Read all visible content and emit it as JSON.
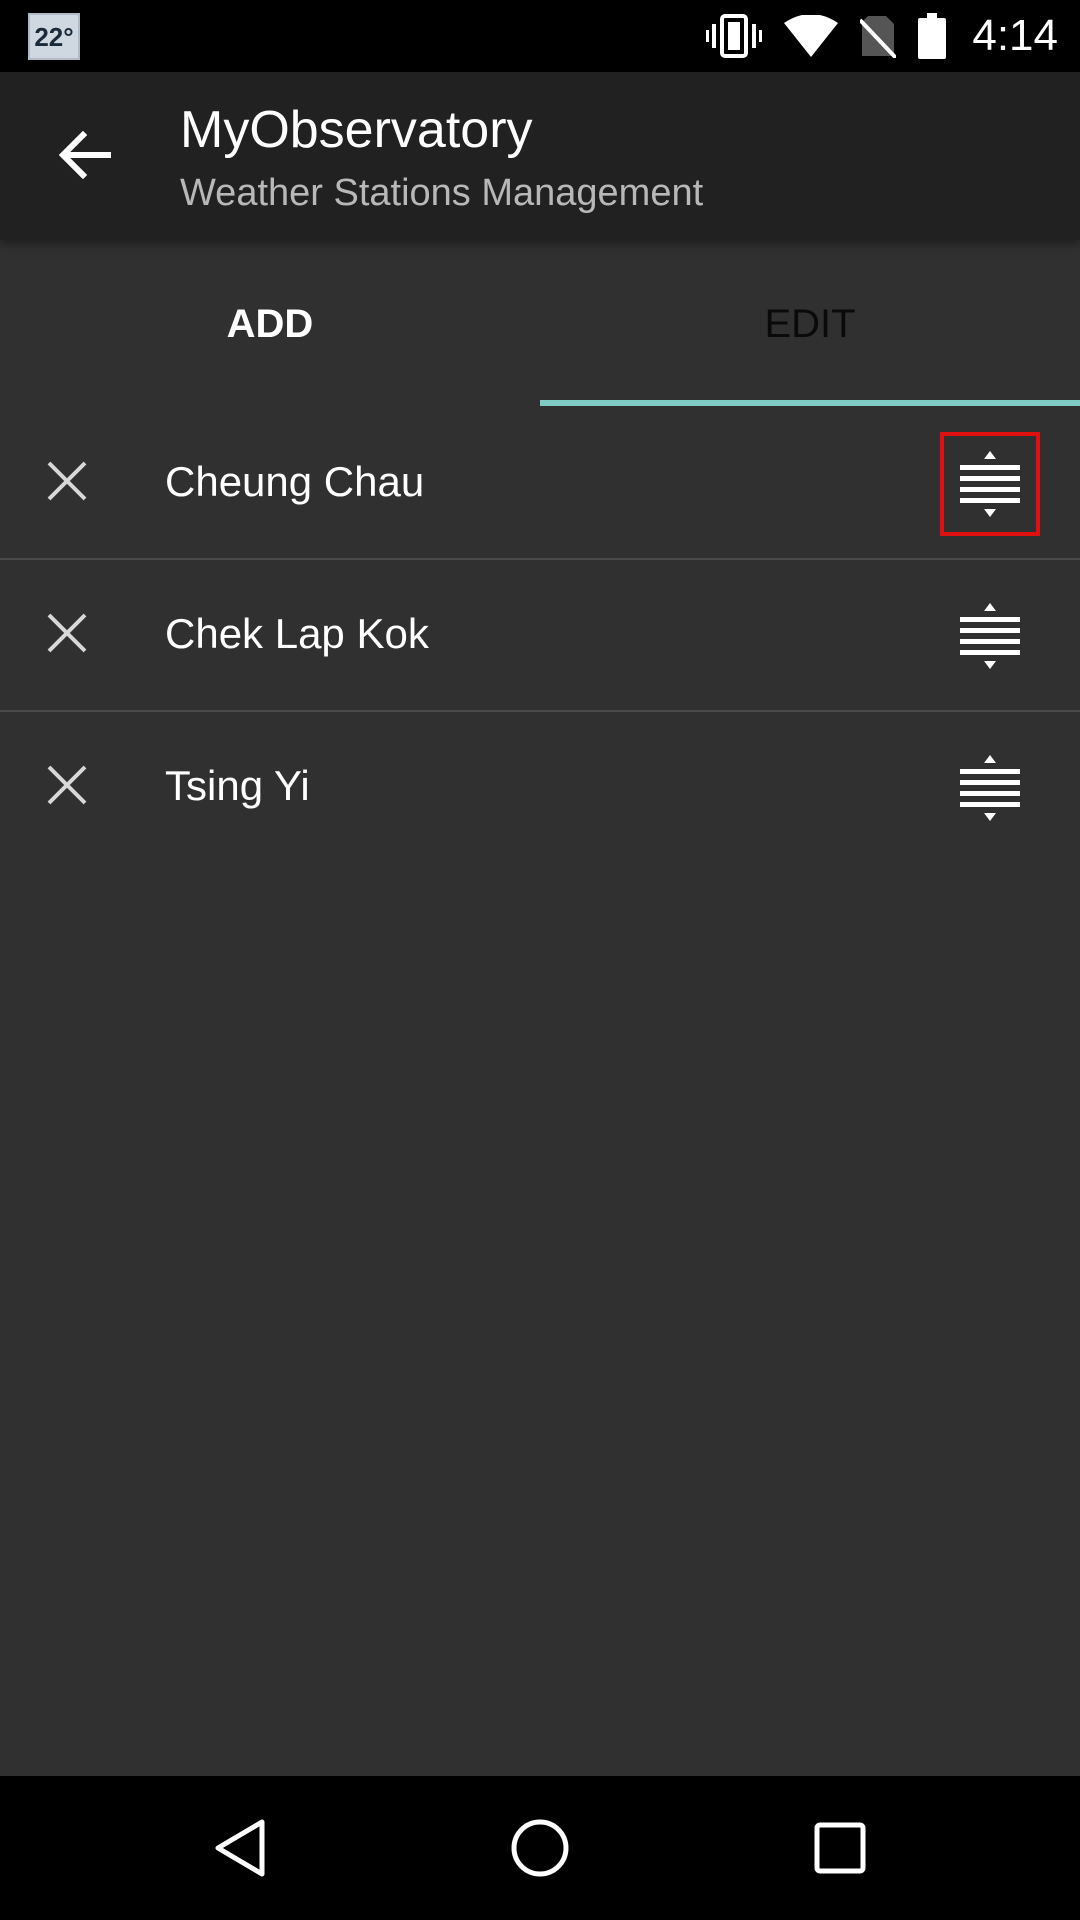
{
  "status_bar": {
    "weather_badge": "22°",
    "time": "4:14",
    "icons": [
      "vibrate-icon",
      "wifi-icon",
      "no-sim-icon",
      "battery-icon"
    ]
  },
  "app_bar": {
    "title": "MyObservatory",
    "subtitle": "Weather Stations Management",
    "back_icon": "arrow-back-icon"
  },
  "tabs": [
    {
      "label": "ADD",
      "selected": false
    },
    {
      "label": "EDIT",
      "selected": true
    }
  ],
  "stations": [
    {
      "name": "Cheung Chau",
      "handle_highlighted": true
    },
    {
      "name": "Chek Lap Kok",
      "handle_highlighted": false
    },
    {
      "name": "Tsing Yi",
      "handle_highlighted": false
    }
  ],
  "colors": {
    "background": "#303030",
    "app_bar": "#212121",
    "tab_indicator": "#80cbc4",
    "highlight_box": "#e01010"
  },
  "nav_bar": {
    "icons": [
      "nav-back-icon",
      "nav-home-icon",
      "nav-recents-icon"
    ]
  }
}
